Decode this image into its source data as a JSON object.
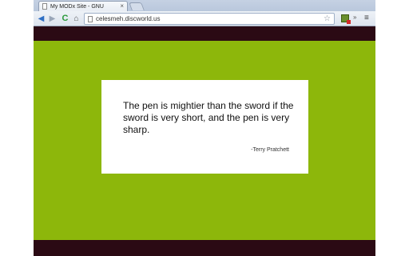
{
  "browser": {
    "tab": {
      "title": "My MODx Site - GNU",
      "close": "×"
    },
    "toolbar": {
      "back": "◀",
      "forward": "▶",
      "reload": "C",
      "home": "⌂",
      "url": "celesmeh.discworld.us",
      "star": "☆",
      "ext_more": "»",
      "menu": "≡"
    }
  },
  "content": {
    "quote": "The pen is mightier than the sword if the sword is very short, and the pen is very sharp.",
    "author": "-Terry Pratchett"
  },
  "colors": {
    "page_background": "#8db70b",
    "bands": "#2b0a14",
    "quote_box": "#ffffff"
  }
}
